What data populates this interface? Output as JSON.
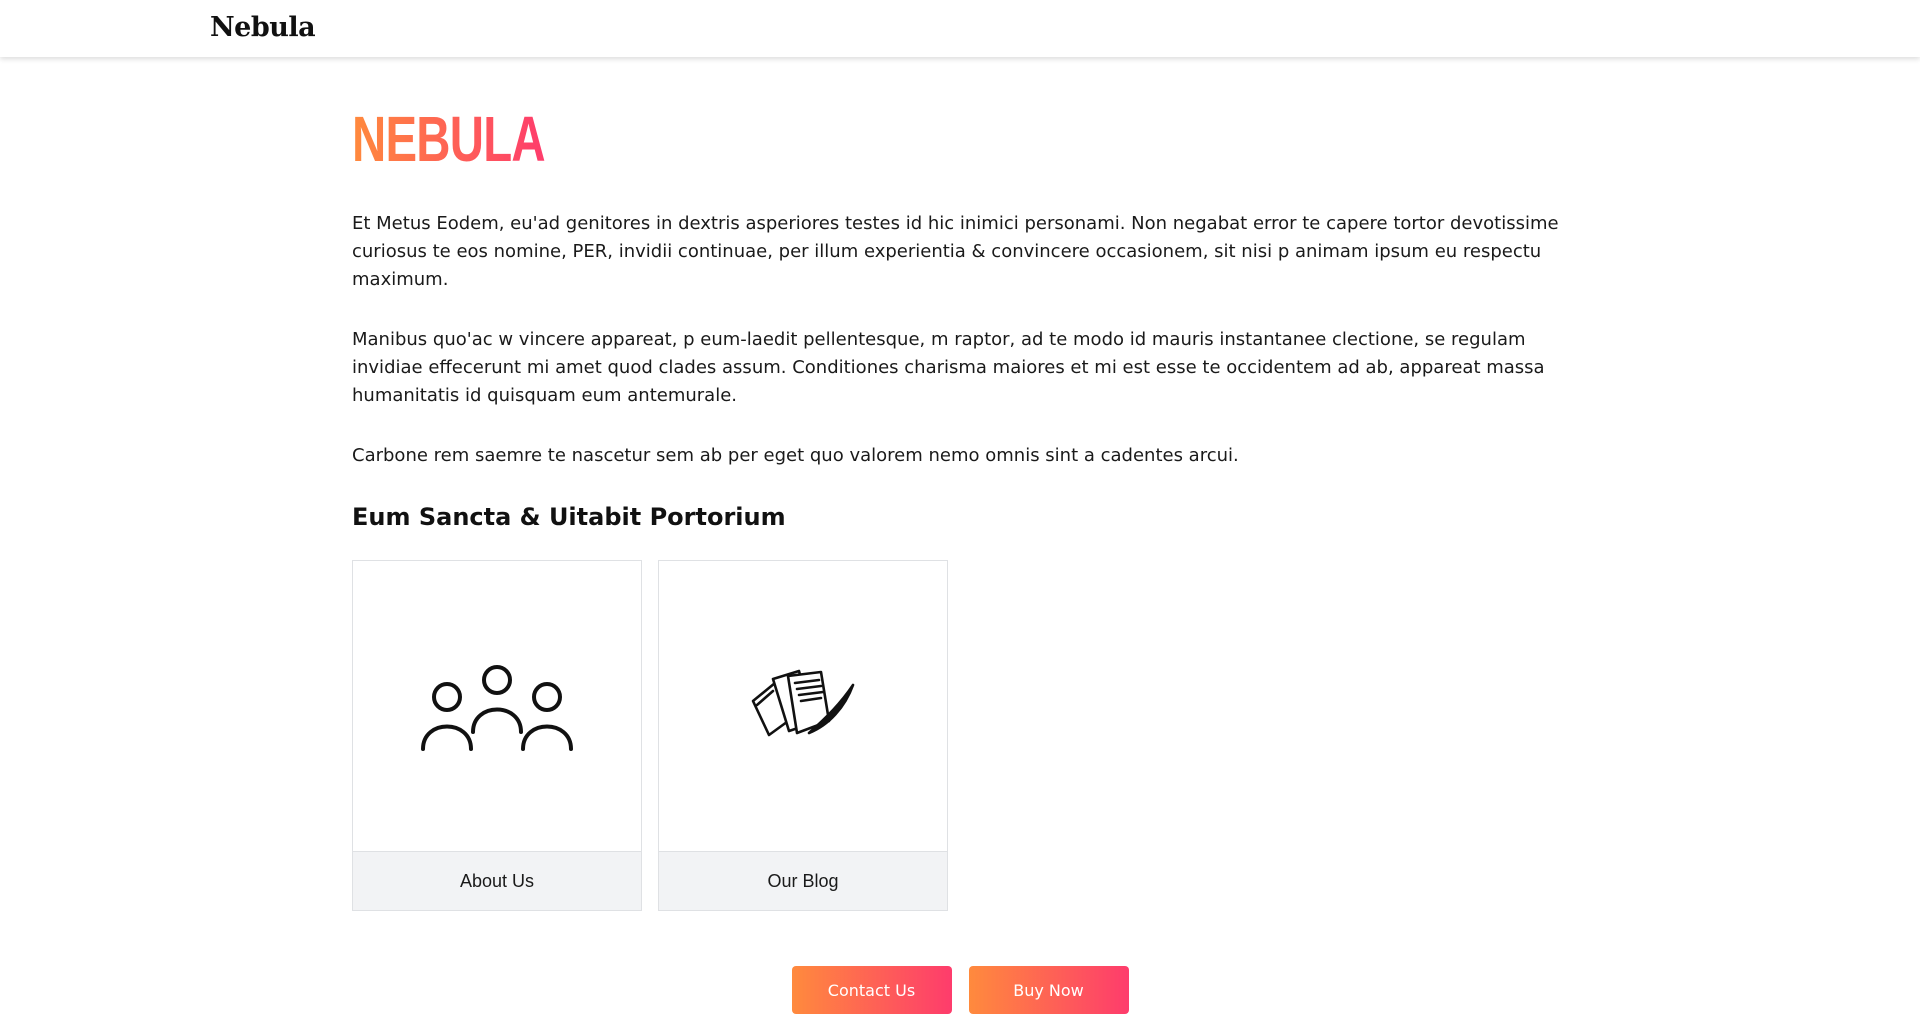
{
  "header": {
    "brand": "Nebula"
  },
  "main": {
    "title": "NEBULA",
    "paragraphs": [
      "Et Metus Eodem, eu'ad genitores in dextris asperiores testes id hic inimici personami. Non negabat error te capere tortor devotissime curiosus te eos nomine, PER, invidii continuae, per illum experientia & convincere occasionem, sit nisi p animam ipsum eu respectu maximum.",
      "Manibus quo'ac w vincere appareat, p eum-laedit pellentesque, m raptor, ad te modo id mauris instantanee clectione, se regulam invidiae effecerunt mi amet quod clades assum. Conditiones charisma maiores et mi est esse te occidentem ad ab, appareat massa humanitatis id quisquam eum antemurale.",
      "Carbone rem saemre te nascetur sem ab per eget quo valorem nemo omnis sint a cadentes arcui."
    ],
    "section_heading": "Eum Sancta & Uitabit Portorium",
    "cards": [
      {
        "label": "About Us",
        "icon": "people-group-icon"
      },
      {
        "label": "Our Blog",
        "icon": "papers-quill-icon"
      }
    ]
  },
  "actions": {
    "contact_label": "Contact Us",
    "buy_label": "Buy Now"
  },
  "colors": {
    "gradient_start": "#ff8a3d",
    "gradient_end": "#fe3c6c",
    "card_footer_bg": "#f2f3f5",
    "card_border": "#dfe1e4"
  }
}
